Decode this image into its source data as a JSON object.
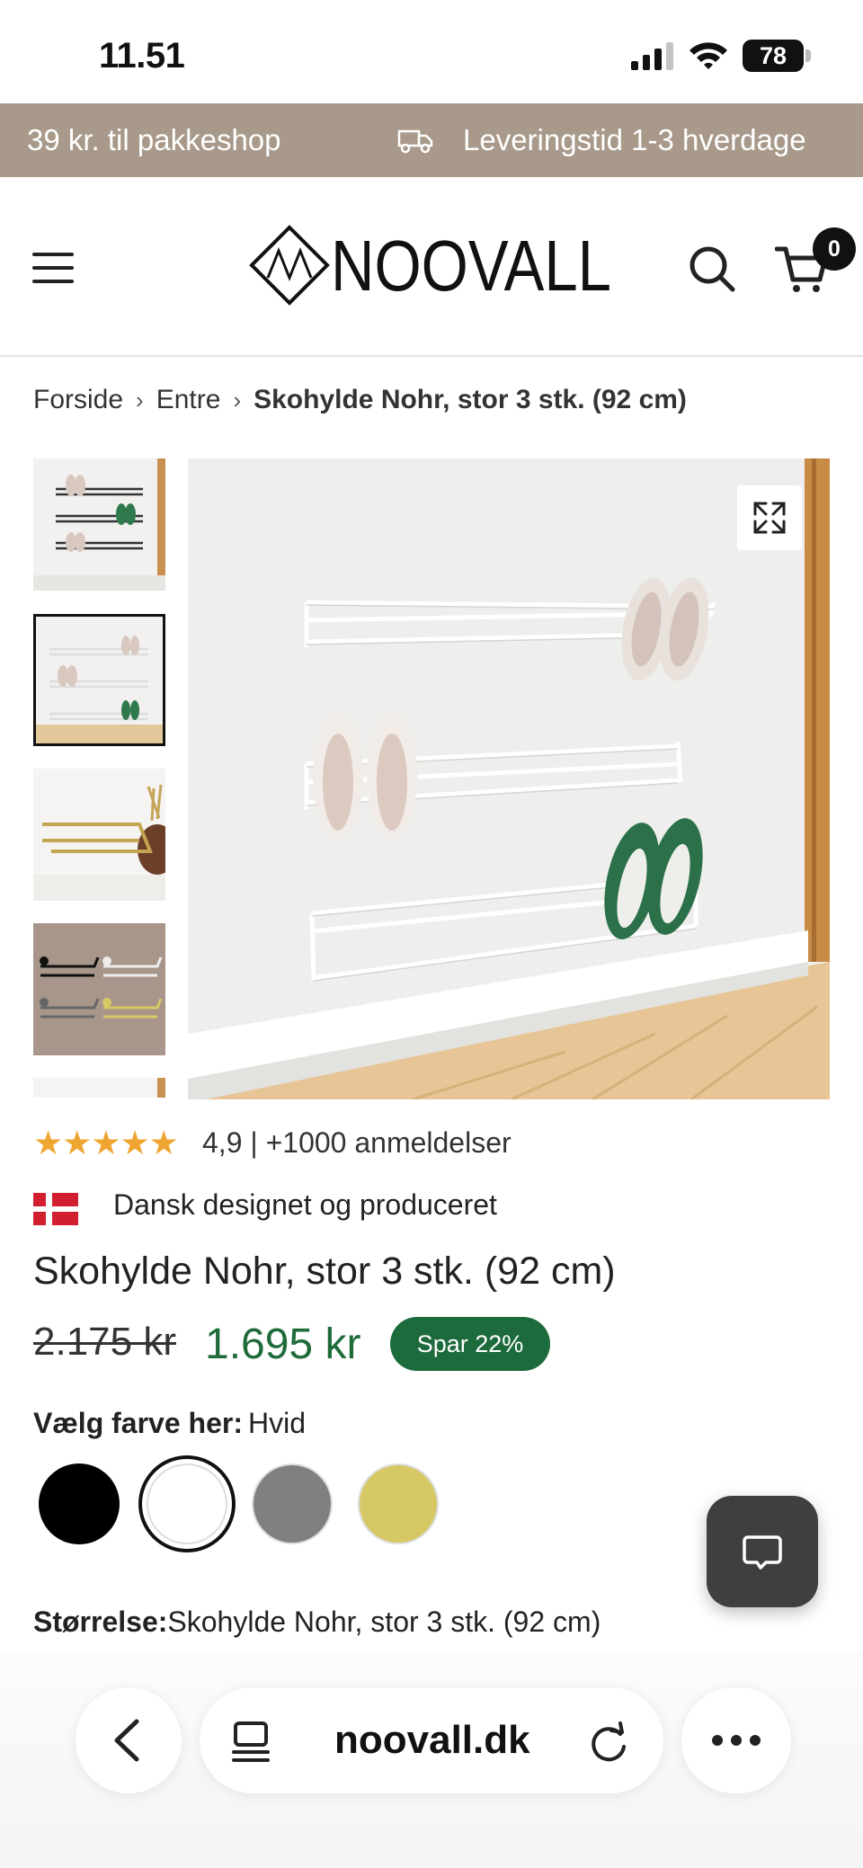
{
  "status_bar": {
    "time": "11.51",
    "battery": "78"
  },
  "announcement": {
    "left": "39 kr. til pakkeshop",
    "right": "Leveringstid 1-3 hverdage"
  },
  "header": {
    "logo_text": "NOOVALL",
    "cart_count": "0"
  },
  "breadcrumb": {
    "items": [
      "Forside",
      "Entre"
    ],
    "separator": "›",
    "current": "Skohylde Nohr, stor 3 stk. (92 cm)"
  },
  "gallery": {
    "thumbnails": [
      {
        "name": "thumbnail-1",
        "active": false
      },
      {
        "name": "thumbnail-2",
        "active": true
      },
      {
        "name": "thumbnail-3",
        "active": false
      },
      {
        "name": "thumbnail-4",
        "active": false
      },
      {
        "name": "thumbnail-5",
        "active": false
      }
    ]
  },
  "rating": {
    "stars": "★★★★★",
    "text": "4,9 | +1000 anmeldelser",
    "value": 4.9
  },
  "origin": {
    "text": "Dansk designet og produceret"
  },
  "product": {
    "title": "Skohylde Nohr, stor 3 stk. (92 cm)",
    "old_price": "2.175 kr",
    "new_price": "1.695 kr",
    "save_badge": "Spar 22%"
  },
  "color": {
    "label": "Vælg farve her:",
    "selected": "Hvid",
    "options": [
      {
        "name": "black",
        "hex": "#000000"
      },
      {
        "name": "white",
        "hex": "#ffffff"
      },
      {
        "name": "grey",
        "hex": "#808080"
      },
      {
        "name": "gold",
        "hex": "#d7c866"
      }
    ]
  },
  "size": {
    "label": "Størrelse:",
    "value": "Skohylde Nohr, stor 3 stk. (92 cm)"
  },
  "browser": {
    "url": "noovall.dk"
  },
  "colors": {
    "announcement_bg": "#a8998a",
    "price_green": "#1f6b3a",
    "badge_green": "#1d6a3c",
    "star_orange": "#efa531",
    "chat_bg": "#3f3f3f"
  }
}
